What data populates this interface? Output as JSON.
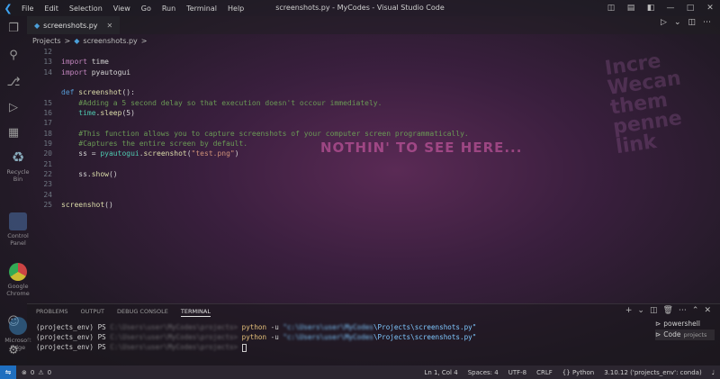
{
  "window": {
    "title": "screenshots.py - MyCodes - Visual Studio Code"
  },
  "menu": [
    "File",
    "Edit",
    "Selection",
    "View",
    "Go",
    "Run",
    "Terminal",
    "Help"
  ],
  "tab": {
    "label": "screenshots.py"
  },
  "breadcrumb": {
    "folder": "Projects",
    "sep": ">",
    "file": "screenshots.py",
    "tail": ">"
  },
  "editor": {
    "lines": [
      {
        "n": "12",
        "html": ""
      },
      {
        "n": "13",
        "html": "<span class=\"kw\">import</span> time"
      },
      {
        "n": "14",
        "html": "<span class=\"kw\">import</span> pyautogui"
      },
      {
        "n": "",
        "html": ""
      },
      {
        "n": "",
        "html": "<span class=\"def\">def</span> <span class=\"fn\">screenshot</span>():"
      },
      {
        "n": "15",
        "html": "    <span class=\"cm\">#Adding a 5 second delay so that execution doesn't occour immediately.</span>"
      },
      {
        "n": "16",
        "html": "    <span class=\"mod\">time</span>.<span class=\"fn\">sleep</span>(5)"
      },
      {
        "n": "17",
        "html": ""
      },
      {
        "n": "18",
        "html": "    <span class=\"cm\">#This function allows you to capture screenshots of your computer screen programmatically.</span>"
      },
      {
        "n": "19",
        "html": "    <span class=\"cm\">#Captures the entire screen by default.</span>"
      },
      {
        "n": "20",
        "html": "    ss = <span class=\"mod\">pyautogui</span>.<span class=\"fn\">screenshot</span>(<span class=\"str\">\"test.png\"</span>)"
      },
      {
        "n": "21",
        "html": ""
      },
      {
        "n": "22",
        "html": "    ss.<span class=\"fn\">show</span>()"
      },
      {
        "n": "23",
        "html": ""
      },
      {
        "n": "24",
        "html": ""
      },
      {
        "n": "25",
        "html": "<span class=\"fn\">screenshot</span>()"
      }
    ]
  },
  "panel": {
    "tabs": [
      "PROBLEMS",
      "OUTPUT",
      "DEBUG CONSOLE",
      "TERMINAL"
    ],
    "active_tab": "TERMINAL"
  },
  "terminal": {
    "env": "(projects_env)",
    "ps": "PS",
    "blurred_path": "C:\\Users\\user\\MyCodes\\projects>",
    "cmd": "python",
    "flag": "-u",
    "blurred_quote": "\"c:\\Users\\user\\MyCodes",
    "path_tail": "\\Projects\\screenshots.py\""
  },
  "shells": [
    {
      "name": "powershell",
      "sub": ""
    },
    {
      "name": "Code",
      "sub": "projects"
    }
  ],
  "status": {
    "errors": "0",
    "warnings": "0",
    "position": "Ln 1, Col 4",
    "spaces": "Spaces: 4",
    "encoding": "UTF-8",
    "eol": "CRLF",
    "language": "Python",
    "interpreter": "3.10.12 ('projects_env': conda)"
  },
  "background": {
    "sign": "NOTHIN' TO SEE HERE..."
  },
  "desktop_icons": [
    "Recycle Bin",
    "Control Panel",
    "Google Chrome",
    "Microsoft Edge"
  ],
  "colors": {
    "accent": "#1f6fbf",
    "keyword": "#c586c0",
    "function": "#dcdcaa",
    "comment": "#6a9955",
    "string": "#ce9178"
  }
}
